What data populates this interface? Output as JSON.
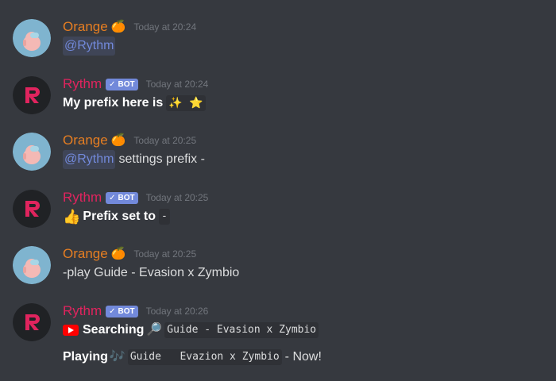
{
  "colors": {
    "background": "#36393f",
    "orange_user": "#e67e22",
    "rythm_user": "#e0245e",
    "bot_tag": "#7289da",
    "mention": "#7289da",
    "timestamp": "#72767d"
  },
  "messages": [
    {
      "author": "Orange",
      "author_emoji": "🍊",
      "timestamp": "Today at 20:24",
      "mention": "@Rythm",
      "text": ""
    },
    {
      "author": "Rythm",
      "bot_label": "BOT",
      "bot_check": "✓",
      "timestamp": "Today at 20:24",
      "bold_text": "My prefix here is",
      "code_emojis": "✨ ⭐"
    },
    {
      "author": "Orange",
      "author_emoji": "🍊",
      "timestamp": "Today at 20:25",
      "mention": "@Rythm",
      "text": "settings prefix -"
    },
    {
      "author": "Rythm",
      "bot_label": "BOT",
      "bot_check": "✓",
      "timestamp": "Today at 20:25",
      "lead_emoji": "👍",
      "bold_text": "Prefix set to",
      "code": "-"
    },
    {
      "author": "Orange",
      "author_emoji": "🍊",
      "timestamp": "Today at 20:25",
      "text": "-play Guide - Evasion x Zymbio"
    },
    {
      "author": "Rythm",
      "bot_label": "BOT",
      "bot_check": "✓",
      "timestamp": "Today at 20:26",
      "searching_label": "Searching",
      "searching_emoji": "🔎",
      "searching_code": "Guide - Evasion x Zymbio",
      "playing_label": "Playing",
      "playing_emoji": "🎶",
      "playing_code": "Guide   Evazion x Zymbio",
      "playing_suffix": "- Now!"
    }
  ]
}
